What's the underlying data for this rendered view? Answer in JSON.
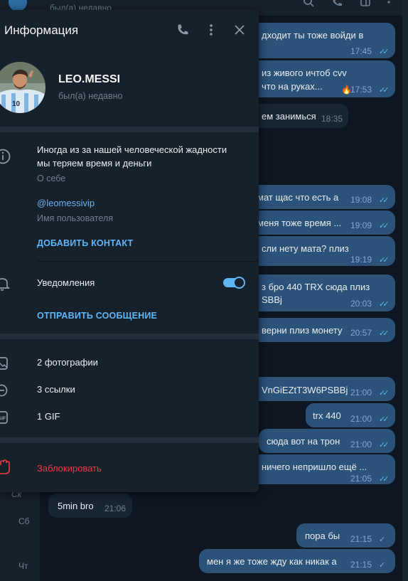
{
  "chat": {
    "header_status": "был(а) недавно",
    "messages": [
      {
        "text": "дходит ты тоже войди в",
        "time": "17:45"
      },
      {
        "text": "  из живого ичтоб cvv",
        "text2": "что на руках...",
        "time": "17:53",
        "emoji": "🔥"
      },
      {
        "text": "ем занимься",
        "time": "18:35"
      },
      {
        "text": "мат  щас что есть а",
        "time": "19:08"
      },
      {
        "text": "меня тоже время ...",
        "time": "19:09"
      },
      {
        "text": "сли нету мата? плиз",
        "time": "19:19"
      },
      {
        "text": "з бро 440 TRX сюда плиз",
        "text2": "SBBj",
        "time": "20:03"
      },
      {
        "text": "верни плиз монету",
        "time": "20:57"
      },
      {
        "text": "VnGiEZtT3W6PSBBj",
        "time": "21:00"
      },
      {
        "text": "trx 440",
        "time": "21:00"
      },
      {
        "text": "сюда вот на трон",
        "time": "21:00"
      },
      {
        "text": "ничего непришло ещё ...",
        "time": "21:05"
      },
      {
        "text": "5min bro",
        "time": "21:06"
      },
      {
        "text": "пора бы",
        "time": "21:15"
      },
      {
        "text": "мен я же тоже жду как никак а",
        "time": "21:15"
      }
    ],
    "left_labels": {
      "ck": "Ск",
      "sat": "Сб",
      "thu": "Чт"
    }
  },
  "info": {
    "title": "Информация",
    "contact_name": "LEO.MESSI",
    "status": "был(а) недавно",
    "bio_line1": "Иногда из за нашей человеческой жадности",
    "bio_line2": "мы теряем время и деньги",
    "bio_label": "О себе",
    "username": "@leomessivip",
    "username_label": "Имя пользователя",
    "add_contact": "ДОБАВИТЬ КОНТАКТ",
    "notifications": "Уведомления",
    "notifications_on": true,
    "send_message": "ОТПРАВИТЬ СООБЩЕНИЕ",
    "photos": "2 фотографии",
    "links": "3 ссылки",
    "gifs": "1 GIF",
    "block": "Заблокировать"
  },
  "colors": {
    "panel": "#17212b",
    "accent": "#5eb5f7",
    "danger": "#ec3942",
    "outgoing": "#2b5278",
    "incoming": "#182533"
  }
}
